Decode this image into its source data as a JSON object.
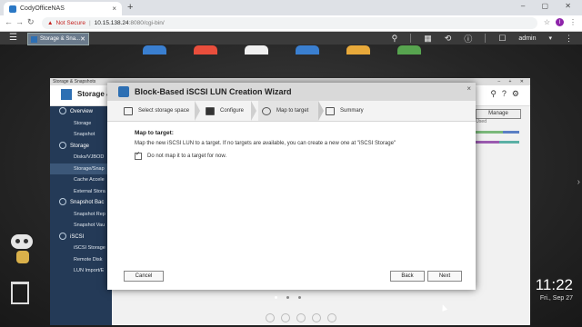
{
  "browser": {
    "tab_title": "CodyOfficeNAS",
    "tab_close": "×",
    "new_tab": "+",
    "security_warning": "Not Secure",
    "host": "10.15.138.24",
    "path": ":8080/cgi-bin/"
  },
  "qts": {
    "task_label": "Storage & Sna...",
    "user": "admin",
    "clock": "11:22",
    "date": "Fri., Sep 27"
  },
  "storage_window": {
    "titlebar": "Storage & Snapshots",
    "title": "Storage &",
    "manage_button": "Manage",
    "used_label": "Used",
    "sidebar": [
      {
        "label": "Overview",
        "group": true
      },
      {
        "label": "Storage",
        "group": false
      },
      {
        "label": "Snapshot",
        "group": false
      },
      {
        "label": "Storage",
        "group": true
      },
      {
        "label": "Disks/VJBOD",
        "group": false
      },
      {
        "label": "Storage/Snap",
        "group": false
      },
      {
        "label": "Cache Accele",
        "group": false
      },
      {
        "label": "External Stora",
        "group": false
      },
      {
        "label": "Snapshot Bac",
        "group": true
      },
      {
        "label": "Snapshot Rep",
        "group": false
      },
      {
        "label": "Snapshot Vau",
        "group": false
      },
      {
        "label": "iSCSI",
        "group": true
      },
      {
        "label": "iSCSI Storage",
        "group": false
      },
      {
        "label": "Remote Disk",
        "group": false
      },
      {
        "label": "LUN Import/E",
        "group": false
      }
    ]
  },
  "wizard": {
    "title": "Block-Based iSCSI LUN Creation Wizard",
    "close": "×",
    "steps": [
      "Select storage space",
      "Configure",
      "Map to target",
      "Summary"
    ],
    "heading": "Map to target:",
    "description": "Map the new iSCSI LUN to a target. If no targets are available, you can create a new one at \"iSCSI Storage\"",
    "checkbox_label": "Do not map it to a target for now.",
    "cancel": "Cancel",
    "back": "Back",
    "next": "Next"
  }
}
